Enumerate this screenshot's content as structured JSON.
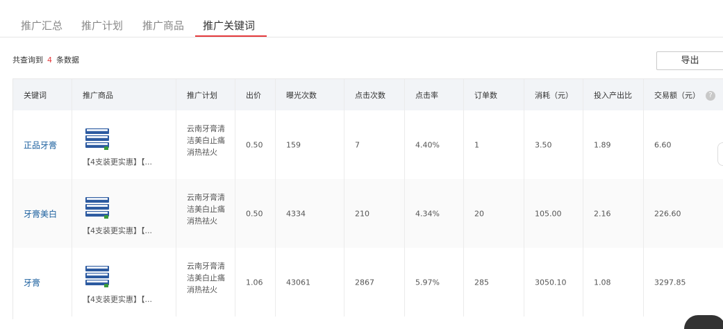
{
  "tabs": [
    {
      "label": "推广汇总",
      "active": false
    },
    {
      "label": "推广计划",
      "active": false
    },
    {
      "label": "推广商品",
      "active": false
    },
    {
      "label": "推广关键词",
      "active": true
    }
  ],
  "summary": {
    "prefix": "共查询到",
    "count": "4",
    "suffix": "条数据"
  },
  "export_label": "导出",
  "colors": {
    "accent": "#e4393c",
    "link": "#1a5f9e",
    "header_bg": "#f2f4f7"
  },
  "table": {
    "headers": [
      "关键词",
      "推广商品",
      "推广计划",
      "出价",
      "曝光次数",
      "点击次数",
      "点击率",
      "订单数",
      "消耗（元）",
      "投入产出比",
      "交易额（元）"
    ],
    "help_icon": "?",
    "rows": [
      {
        "keyword": "正品牙膏",
        "product": "【4支装更实惠】【...",
        "plan": "云南牙膏清洁美白止痛消热祛火",
        "bid": "0.50",
        "impressions": "159",
        "clicks": "7",
        "ctr": "4.40%",
        "orders": "1",
        "cost": "3.50",
        "roi": "1.89",
        "gmv": "6.60"
      },
      {
        "keyword": "牙膏美白",
        "product": "【4支装更实惠】【...",
        "plan": "云南牙膏清洁美白止痛消热祛火",
        "bid": "0.50",
        "impressions": "4334",
        "clicks": "210",
        "ctr": "4.34%",
        "orders": "20",
        "cost": "105.00",
        "roi": "2.16",
        "gmv": "226.60"
      },
      {
        "keyword": "牙膏",
        "product": "【4支装更实惠】【...",
        "plan": "云南牙膏清洁美白止痛消热祛火",
        "bid": "1.06",
        "impressions": "43061",
        "clicks": "2867",
        "ctr": "5.97%",
        "orders": "285",
        "cost": "3050.10",
        "roi": "1.08",
        "gmv": "3297.85"
      }
    ]
  }
}
